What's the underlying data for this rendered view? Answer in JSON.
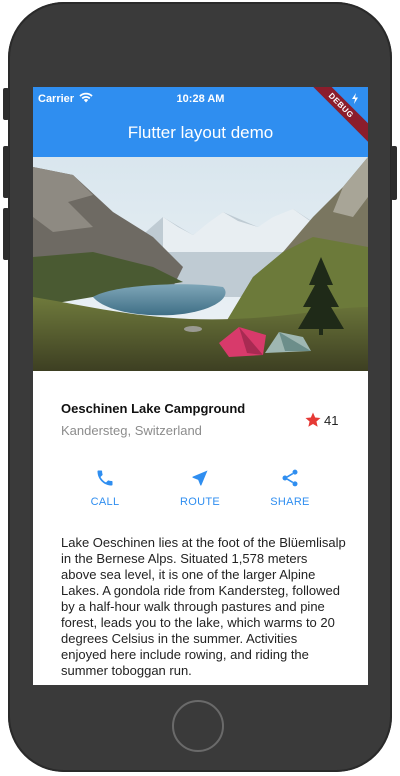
{
  "status_bar": {
    "carrier": "Carrier",
    "time": "10:28 AM"
  },
  "app_bar": {
    "title": "Flutter layout demo",
    "debug_banner": "DEBUG",
    "color": "#2f8ef0"
  },
  "place": {
    "name": "Oeschinen Lake Campground",
    "location": "Kandersteg, Switzerland",
    "star_count": "41",
    "star_color": "#e53935"
  },
  "actions": [
    {
      "label": "CALL",
      "icon": "phone-icon"
    },
    {
      "label": "ROUTE",
      "icon": "near-me-icon"
    },
    {
      "label": "SHARE",
      "icon": "share-icon"
    }
  ],
  "description": "Lake Oeschinen lies at the foot of the Blüemlisalp in the Bernese Alps. Situated 1,578 meters above sea level, it is one of the larger Alpine Lakes. A gondola ride from Kandersteg, followed by a half-hour walk through pastures and pine forest, leads you to the lake, which warms to 20 degrees Celsius in the summer. Activities enjoyed here include rowing, and riding the summer toboggan run."
}
